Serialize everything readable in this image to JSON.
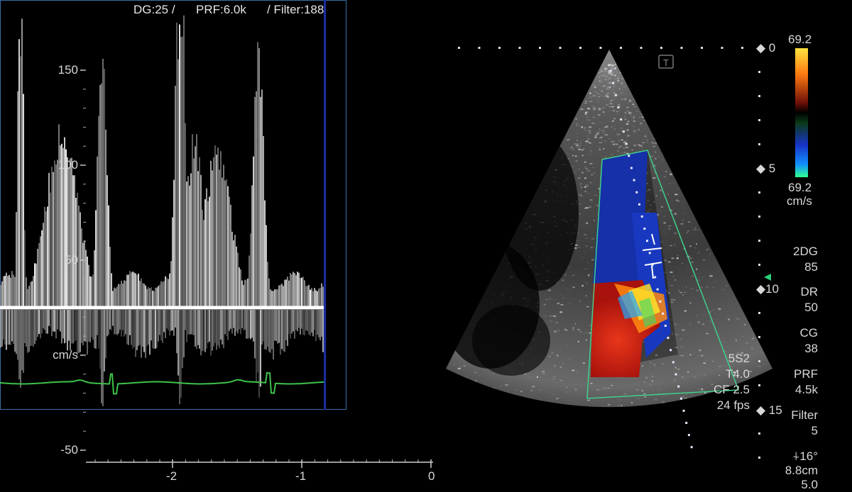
{
  "doppler": {
    "header_dg": "DG:25 /",
    "header_prf": "PRF:6.0k",
    "header_filter": "/ Filter:188",
    "velocity_unit": "cm/s",
    "y_ticks": [
      "150",
      "100",
      "50",
      "-50"
    ],
    "x_ticks": [
      "-2",
      "-1",
      "0"
    ]
  },
  "color_scale": {
    "top_value": "69.2",
    "bottom_value": "69.2",
    "unit": "cm/s"
  },
  "depth_scale": {
    "marks": [
      "0",
      "5",
      "10",
      "15"
    ]
  },
  "probe_info": {
    "probe": "5S2",
    "tissue": "T4.0",
    "cf": "CF 2.5",
    "fps": "24 fps"
  },
  "params": [
    {
      "label": "2DG",
      "value": "85"
    },
    {
      "label": "DR",
      "value": "50"
    },
    {
      "label": "CG",
      "value": "38"
    },
    {
      "label": "PRF",
      "value": "4.5k"
    },
    {
      "label": "Filter",
      "value": "5"
    }
  ],
  "angle": "16°",
  "depth": "8.8cm",
  "bottom_value": "5.0",
  "colors": {
    "panel_border": "#3a6ea8",
    "ecg": "#3ec44a",
    "roi_box": "#3fd08a"
  }
}
